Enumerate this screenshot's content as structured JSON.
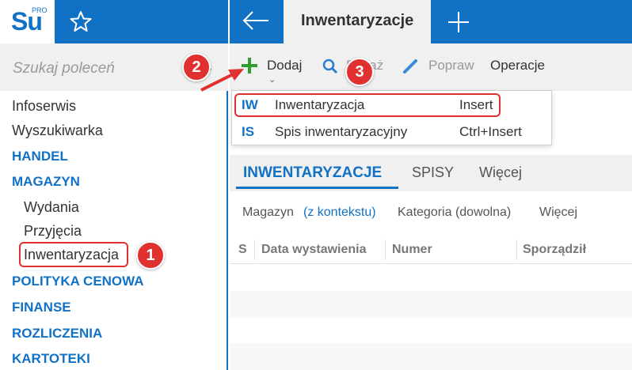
{
  "app": {
    "logo_text": "Su",
    "logo_sup": "PRO"
  },
  "sidebar": {
    "search_placeholder": "Szukaj poleceń",
    "items": [
      {
        "label": "Infoserwis",
        "type": "item"
      },
      {
        "label": "Wyszukiwarka",
        "type": "item"
      },
      {
        "label": "HANDEL",
        "type": "group"
      },
      {
        "label": "MAGAZYN",
        "type": "group"
      },
      {
        "label": "Wydania",
        "type": "sub"
      },
      {
        "label": "Przyjęcia",
        "type": "sub"
      },
      {
        "label": "Inwentaryzacja",
        "type": "sub"
      },
      {
        "label": "POLITYKA CENOWA",
        "type": "group"
      },
      {
        "label": "FINANSE",
        "type": "group"
      },
      {
        "label": "ROZLICZENIA",
        "type": "group"
      },
      {
        "label": "KARTOTEKI",
        "type": "group"
      }
    ]
  },
  "header": {
    "active_tab": "Inwentaryzacje"
  },
  "toolbar": {
    "add": "Dodaj",
    "show": "Pokaż",
    "edit": "Popraw",
    "ops": "Operacje"
  },
  "menu": {
    "items": [
      {
        "code": "IW",
        "label": "Inwentaryzacja",
        "shortcut": "Insert"
      },
      {
        "code": "IS",
        "label": "Spis inwentaryzacyjny",
        "shortcut": "Ctrl+Insert"
      }
    ]
  },
  "section_tabs": [
    "INWENTARYZACJE",
    "SPISY",
    "Więcej"
  ],
  "filters": {
    "warehouse": "Magazyn",
    "warehouse_ctx": "(z kontekstu)",
    "category": "Kategoria (dowolna)",
    "more": "Więcej"
  },
  "grid": {
    "columns": [
      "S",
      "Data wystawienia",
      "Numer",
      "Sporządził"
    ]
  },
  "callouts": [
    "1",
    "2",
    "3"
  ],
  "colors": {
    "accent": "#1172c5",
    "callout": "#e03030",
    "add_green": "#2e9e2e"
  }
}
